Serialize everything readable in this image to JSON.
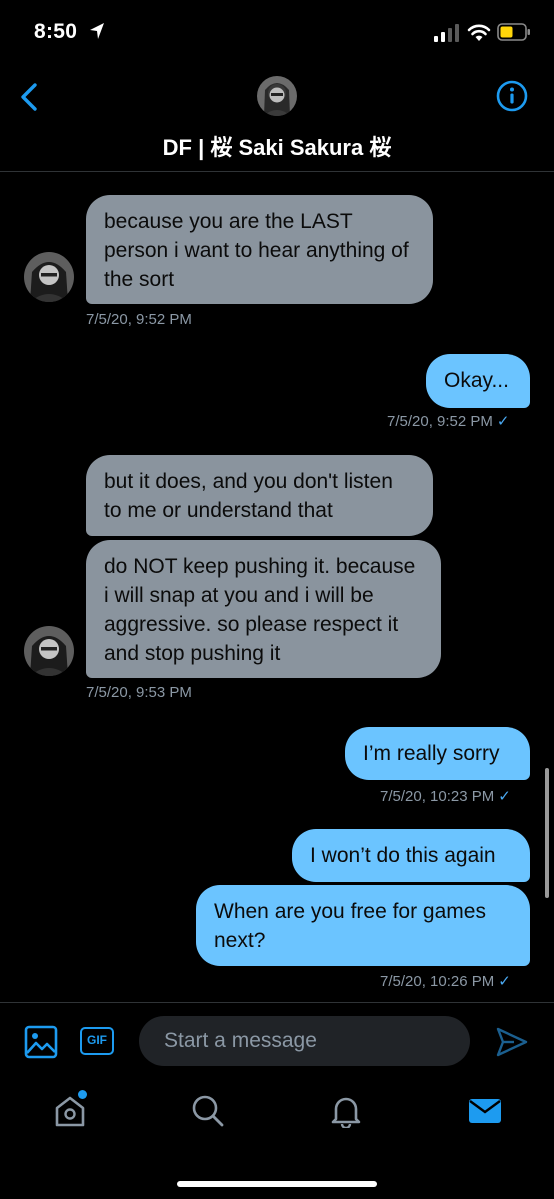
{
  "status_bar": {
    "time": "8:50"
  },
  "header": {
    "title": "DF | 桜 Saki Sakura 桜"
  },
  "messages": [
    {
      "text": "because you are the LAST person i want to hear anything of the sort",
      "timestamp": "7/5/20, 9:52 PM"
    },
    {
      "text": "Okay...",
      "timestamp": "7/5/20, 9:52 PM"
    },
    {
      "text": "but it does, and you don't listen to me or understand that"
    },
    {
      "text": "do NOT keep pushing it. because i will snap at you and i will be aggressive. so please respect it and stop pushing it",
      "timestamp": "7/5/20, 9:53 PM"
    },
    {
      "text": "I’m really sorry",
      "timestamp": "7/5/20, 10:23 PM"
    },
    {
      "text": "I won’t do this again"
    },
    {
      "text": "When are you free for games next?",
      "timestamp": "7/5/20, 10:26 PM"
    }
  ],
  "read_check": "✓",
  "composer": {
    "placeholder": "Start a message",
    "gif_label": "GIF"
  },
  "colors": {
    "accent": "#1d9bf0",
    "incoming_bubble": "#8a949e",
    "outgoing_bubble": "#6bc4ff"
  },
  "tabs": [
    "home-icon",
    "search-icon",
    "bell-icon",
    "mail-icon"
  ]
}
